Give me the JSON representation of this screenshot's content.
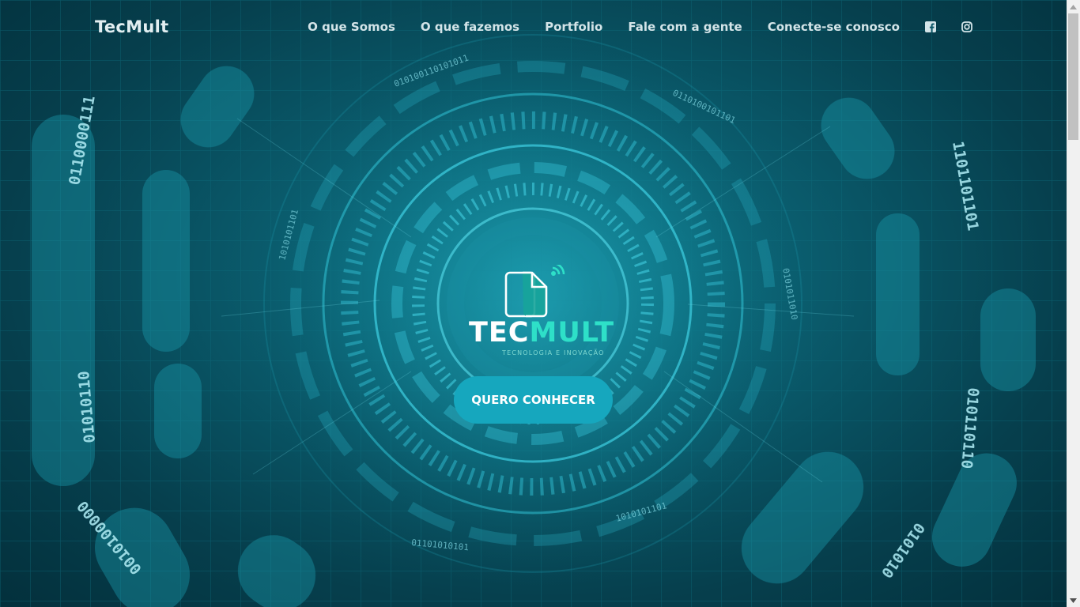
{
  "navbar": {
    "brand": "TecMult",
    "links": [
      {
        "label": "O que Somos"
      },
      {
        "label": "O que fazemos"
      },
      {
        "label": "Portfolio"
      },
      {
        "label": "Fale com a gente"
      },
      {
        "label": "Conecte-se conosco"
      }
    ],
    "social_icons": [
      "facebook-icon",
      "instagram-icon"
    ]
  },
  "hero": {
    "logo_word_part1": "TEC",
    "logo_word_part2": "MULT",
    "logo_tagline": "TECNOLOGIA E INOVAÇÃO",
    "cta_label": "QUERO CONHECER"
  },
  "background": {
    "binary_left": "0110000111001010110101011001010100000011",
    "binary_right": "1101101101101101010101101100101010010110",
    "binary_inner": "0101001101010110100101101010101011010"
  },
  "colors": {
    "accent": "#16a7be",
    "logo_accent": "#2ee0c8",
    "background_dark": "#063f4d",
    "nav_text": "#d3e4e8"
  }
}
